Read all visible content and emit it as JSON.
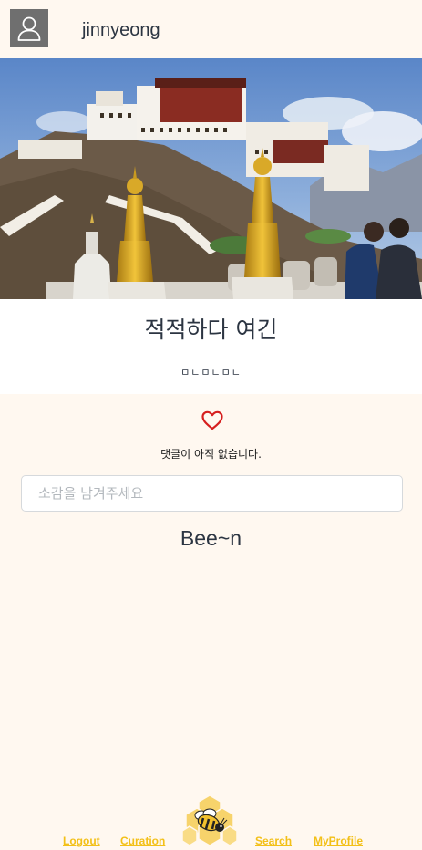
{
  "header": {
    "username": "jinnyeong",
    "avatar_icon": "user-icon"
  },
  "post": {
    "image_icon": "palace-photo",
    "title": "적적하다 여긴",
    "body": "ㅁㄴㅁㄴㅁㄴ"
  },
  "actions": {
    "like_icon": "heart-icon",
    "like_color": "#d61f1f"
  },
  "comments": {
    "empty_text": "댓글이 아직 없습니다.",
    "input_placeholder": "소감을 남겨주세요"
  },
  "brand": {
    "name": "Bee~n"
  },
  "nav": {
    "logout": "Logout",
    "curation": "Curation",
    "search": "Search",
    "myprofile": "MyProfile",
    "logo_icon": "bee-icon",
    "link_color": "#f3c018"
  }
}
